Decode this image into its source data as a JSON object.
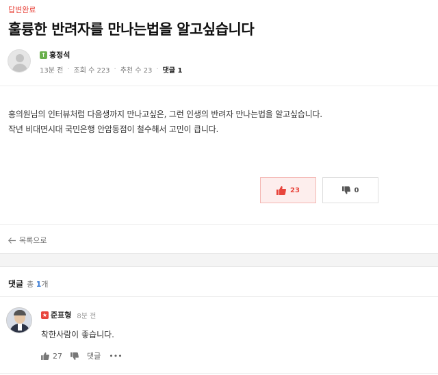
{
  "post": {
    "status_label": "답변완료",
    "title": "훌륭한 반려자를 만나는법을 알고싶습니다",
    "author": {
      "badge_icon": "level-badge-green",
      "badge_text": "↑",
      "name": "홍정석"
    },
    "meta": {
      "time": "13분 전",
      "views": "조회 수 223",
      "recommends": "추천 수 23",
      "comments_label": "댓글 1"
    },
    "body_lines": [
      "홍의원님의 인터뷰처럼 다음생까지 만나고싶은, 그런 인생의 반려자 만나는법을 알고싶습니다.",
      "작년 비대면시대 국민은행 안암동점이 철수해서 고민이 큽니다."
    ],
    "votes": {
      "up_count": "23",
      "down_count": "0",
      "up_color": "#e8453c"
    }
  },
  "navigation": {
    "back_label": "목록으로"
  },
  "comments_section": {
    "label": "댓글",
    "total_prefix": "총",
    "total_count": "1",
    "total_suffix": "개",
    "items": [
      {
        "badge_icon": "level-badge-red",
        "badge_text": "★",
        "author": "준표형",
        "time": "8분 전",
        "text": "착한사람이 좋습니다.",
        "likes": "27",
        "reply_label": "댓글",
        "more_label": "•••"
      }
    ]
  }
}
